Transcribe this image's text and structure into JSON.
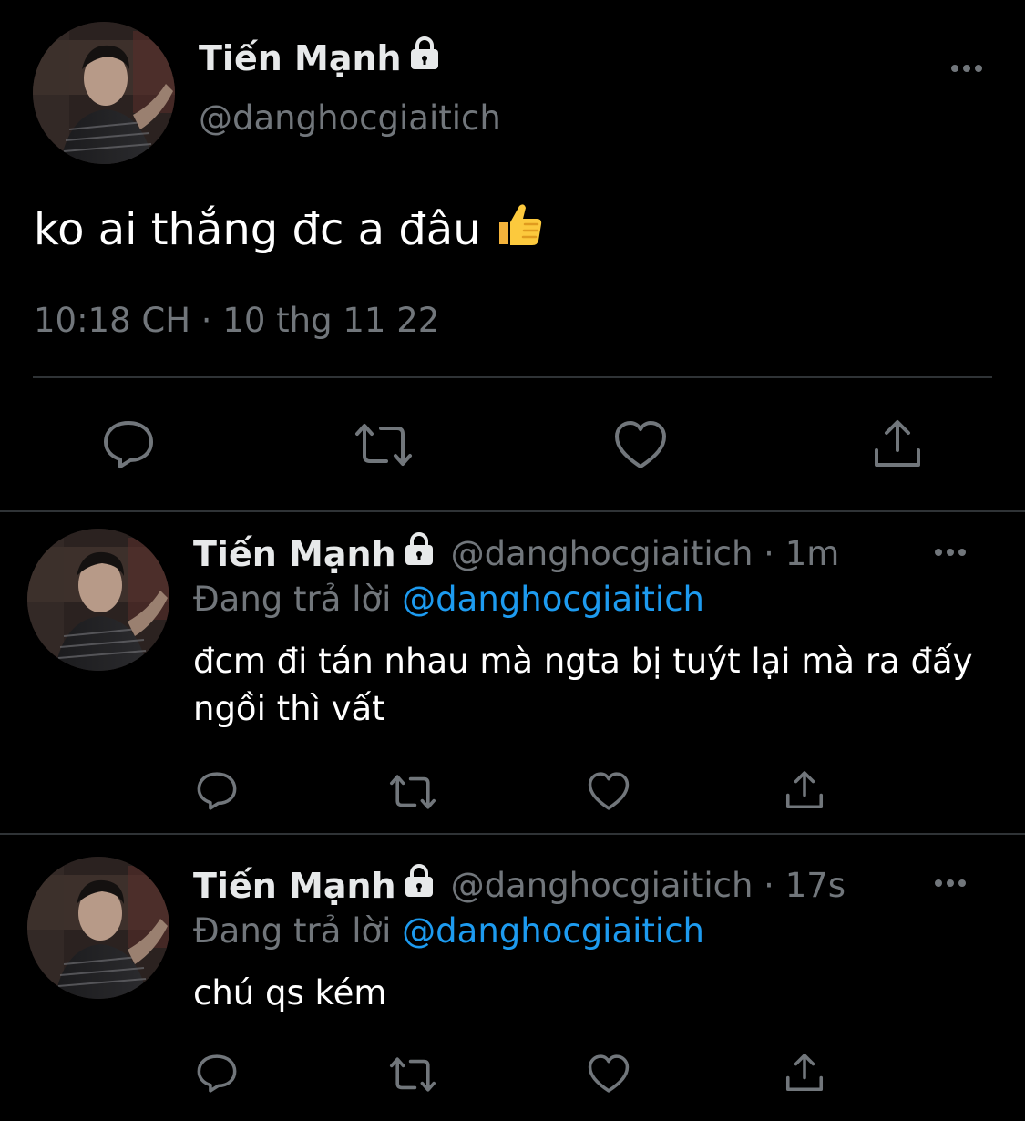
{
  "main_tweet": {
    "author_name": "Tiến Mạnh",
    "handle": "@danghocgiaitich",
    "text": "ko ai thắng đc a đâu",
    "emoji": "👍",
    "timestamp": "10:18 CH · 10 thg 11 22",
    "icons": [
      "lock-icon",
      "more-icon",
      "reply-icon",
      "retweet-icon",
      "like-icon",
      "share-icon"
    ]
  },
  "replies": [
    {
      "author_name": "Tiến Mạnh",
      "handle_time": "@danghocgiaitich · 1m",
      "replying_label": "Đang trả lời",
      "replying_to": "@danghocgiaitich",
      "text": "đcm đi tán nhau mà ngta bị tuýt lại mà ra đấy ngồi thì vất"
    },
    {
      "author_name": "Tiến Mạnh",
      "handle_time": "@danghocgiaitich · 17s",
      "replying_label": "Đang trả lời",
      "replying_to": "@danghocgiaitich",
      "text": "chú qs kém"
    }
  ],
  "colors": {
    "background": "#000000",
    "text_primary": "#e7e9ea",
    "text_secondary": "#71767b",
    "link": "#1d9bf0",
    "divider": "#2f3336"
  }
}
